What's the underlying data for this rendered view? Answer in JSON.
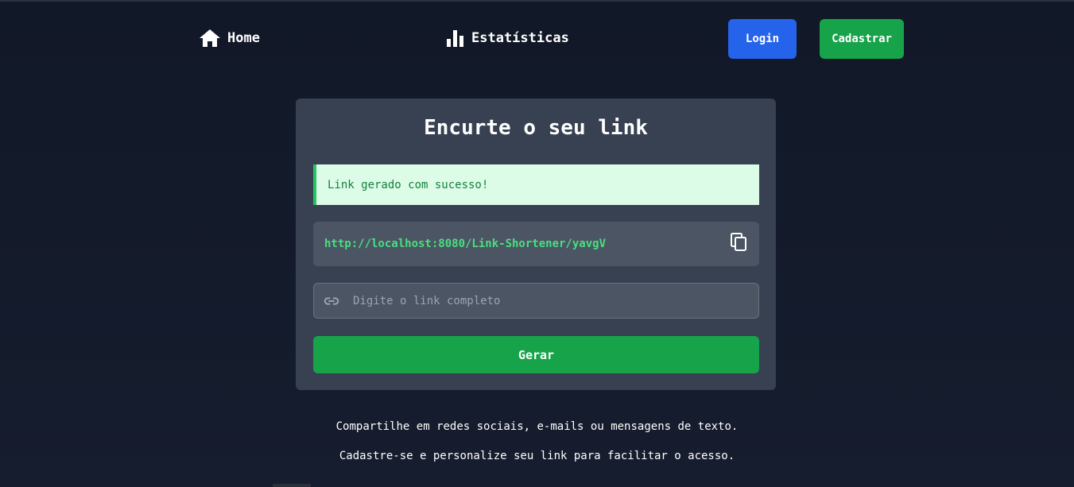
{
  "nav": {
    "home_label": "Home",
    "stats_label": "Estatísticas",
    "login_label": "Login",
    "signup_label": "Cadastrar"
  },
  "card": {
    "title": "Encurte o seu link",
    "alert_message": "Link gerado com sucesso!",
    "short_link": "http://localhost:8080/Link-Shortener/yavgV",
    "input_placeholder": "Digite o link completo",
    "generate_label": "Gerar"
  },
  "footer": {
    "line1": "Compartilhe em redes sociais, e-mails ou mensagens de texto.",
    "line2": "Cadastre-se e personalize seu link para facilitar o acesso."
  },
  "icons": {
    "home": "home-icon",
    "stats": "bar-chart-icon",
    "copy": "copy-icon",
    "link": "link-icon"
  },
  "colors": {
    "background": "#111827",
    "card": "#374151",
    "login_button": "#2563eb",
    "signup_button": "#16a34a",
    "generate_button": "#16a34a",
    "success_bg": "#dcfce7",
    "success_border": "#22c55e",
    "link_text": "#4ade80"
  }
}
